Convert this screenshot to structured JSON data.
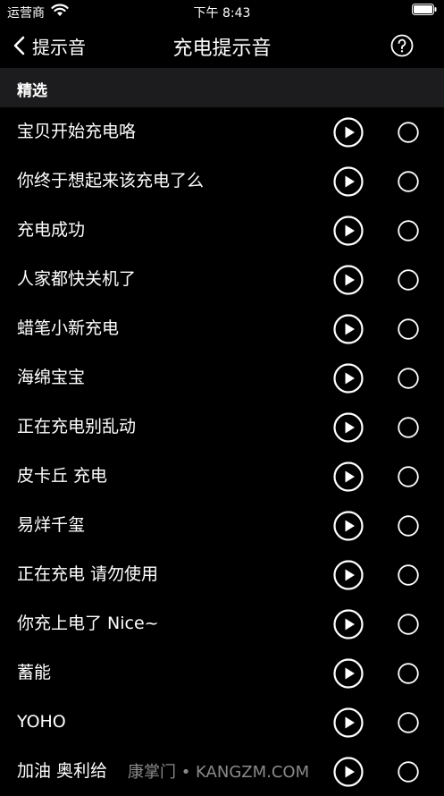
{
  "status_bar": {
    "carrier": "运营商",
    "time": "下午 8:43"
  },
  "nav": {
    "back_label": "提示音",
    "title": "充电提示音"
  },
  "section": {
    "title": "精选"
  },
  "sounds": [
    "宝贝开始充电咯",
    "你终于想起来该充电了么",
    "充电成功",
    "人家都快关机了",
    "蜡笔小新充电",
    "海绵宝宝",
    "正在充电别乱动",
    "皮卡丘 充电",
    "易烊千玺",
    "正在充电 请勿使用",
    "你充上电了 Nice~",
    "蓄能",
    "YOHO",
    "加油 奥利给"
  ],
  "watermark": "康掌门 • KANGZM.COM",
  "icons": {
    "back": "chevron-left-icon",
    "help": "question-circle-icon",
    "play": "play-circle-icon",
    "radio": "radio-circle-icon"
  },
  "colors": {
    "background": "#000000",
    "section_background": "#1c1c1e",
    "text": "#ffffff"
  }
}
